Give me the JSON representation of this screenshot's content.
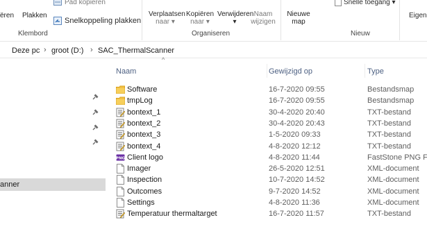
{
  "ribbon": {
    "copy_partial": "ëren",
    "paste": "Plakken",
    "copy_path": "Pad kopiëren",
    "paste_shortcut": "Snelkoppeling plakken",
    "group_clipboard": "Klembord",
    "move_to": "Verplaatsen",
    "move_to_sub": "naar",
    "copy_to": "Kopiëren",
    "copy_to_sub": "naar",
    "delete": "Verwijderen",
    "rename_1": "Naam",
    "rename_2": "wijzigen",
    "group_organize": "Organiseren",
    "new_folder_1": "Nieuwe",
    "new_folder_2": "map",
    "easy_access": "Snelle toegang",
    "group_new": "Nieuw",
    "properties_partial": "Eigen"
  },
  "address": {
    "crumbs": [
      "Deze pc",
      "groot (D:)",
      "SAC_ThermalScanner"
    ]
  },
  "nav": {
    "selected_label": "anner"
  },
  "columns": {
    "name": "Naam",
    "date": "Gewijzigd op",
    "type": "Type"
  },
  "files": [
    {
      "name": "Software",
      "date": "16-7-2020 09:55",
      "type": "Bestandsmap",
      "icon": "folder-icon"
    },
    {
      "name": "tmpLog",
      "date": "16-7-2020 09:55",
      "type": "Bestandsmap",
      "icon": "folder-icon"
    },
    {
      "name": "bontext_1",
      "date": "30-4-2020 20:40",
      "type": "TXT-bestand",
      "icon": "text-file-icon"
    },
    {
      "name": "bontext_2",
      "date": "30-4-2020 20:43",
      "type": "TXT-bestand",
      "icon": "text-file-icon"
    },
    {
      "name": "bontext_3",
      "date": "1-5-2020 09:33",
      "type": "TXT-bestand",
      "icon": "text-file-icon"
    },
    {
      "name": "bontext_4",
      "date": "4-8-2020 12:12",
      "type": "TXT-bestand",
      "icon": "text-file-icon"
    },
    {
      "name": "Client logo",
      "date": "4-8-2020 11:44",
      "type": "FastStone PNG File",
      "icon": "png-file-icon"
    },
    {
      "name": "Imager",
      "date": "26-5-2020 12:51",
      "type": "XML-document",
      "icon": "xml-file-icon"
    },
    {
      "name": "Inspection",
      "date": "10-7-2020 14:52",
      "type": "XML-document",
      "icon": "xml-file-icon"
    },
    {
      "name": "Outcomes",
      "date": "9-7-2020 14:52",
      "type": "XML-document",
      "icon": "xml-file-icon"
    },
    {
      "name": "Settings",
      "date": "4-8-2020 11:36",
      "type": "XML-document",
      "icon": "xml-file-icon"
    },
    {
      "name": "Temperatuur thermaltarget",
      "date": "16-7-2020 11:57",
      "type": "TXT-bestand",
      "icon": "text-file-icon"
    }
  ]
}
